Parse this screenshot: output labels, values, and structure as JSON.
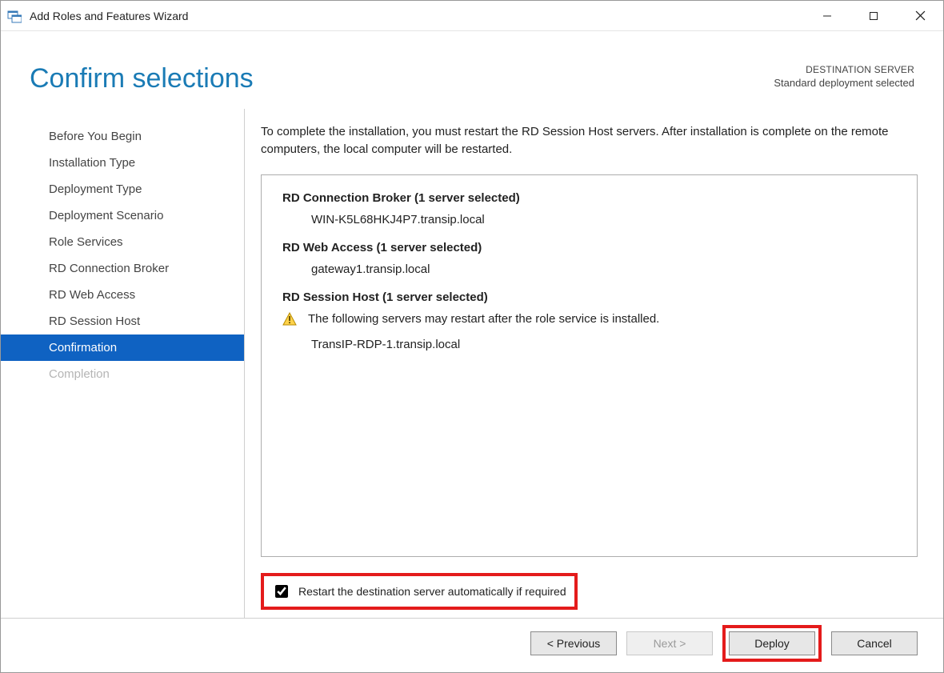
{
  "window": {
    "title": "Add Roles and Features Wizard"
  },
  "header": {
    "page_title": "Confirm selections",
    "dest_label": "DESTINATION SERVER",
    "dest_value": "Standard deployment selected"
  },
  "sidebar": {
    "steps": [
      {
        "label": "Before You Begin",
        "state": "normal"
      },
      {
        "label": "Installation Type",
        "state": "normal"
      },
      {
        "label": "Deployment Type",
        "state": "normal"
      },
      {
        "label": "Deployment Scenario",
        "state": "normal"
      },
      {
        "label": "Role Services",
        "state": "normal"
      },
      {
        "label": "RD Connection Broker",
        "state": "normal"
      },
      {
        "label": "RD Web Access",
        "state": "normal"
      },
      {
        "label": "RD Session Host",
        "state": "normal"
      },
      {
        "label": "Confirmation",
        "state": "selected"
      },
      {
        "label": "Completion",
        "state": "disabled"
      }
    ]
  },
  "main": {
    "intro": "To complete the installation, you must restart the RD Session Host servers. After installation is complete on the remote computers, the local computer will be restarted.",
    "sections": [
      {
        "head": "RD Connection Broker  (1 server selected)",
        "items": [
          "WIN-K5L68HKJ4P7.transip.local"
        ]
      },
      {
        "head": "RD Web Access  (1 server selected)",
        "items": [
          "gateway1.transip.local"
        ]
      },
      {
        "head": "RD Session Host  (1 server selected)",
        "warning": "The following servers may restart after the role service is installed.",
        "items": [
          "TransIP-RDP-1.transip.local"
        ]
      }
    ],
    "restart_label": "Restart the destination server automatically if required",
    "restart_checked": true
  },
  "footer": {
    "previous": "< Previous",
    "next": "Next >",
    "deploy": "Deploy",
    "cancel": "Cancel"
  },
  "icons": {
    "app": "server-manager-icon",
    "warning": "warning-icon"
  }
}
